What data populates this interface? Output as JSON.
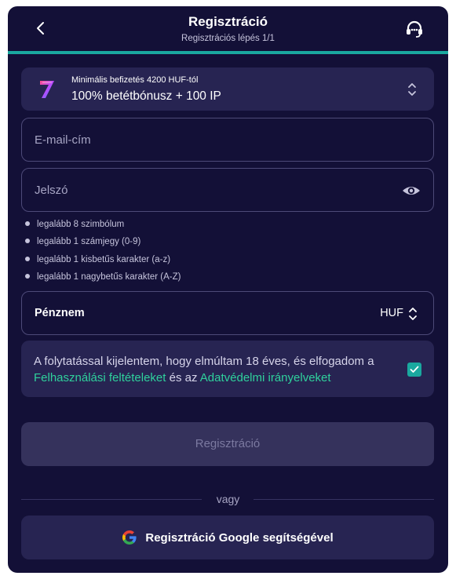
{
  "header": {
    "title": "Regisztráció",
    "subtitle": "Regisztrációs lépés 1/1",
    "back_icon": "chevron-left-icon",
    "support_icon": "headset-icon"
  },
  "progress": {
    "value": 1.0,
    "color": "#1aa89f"
  },
  "bonus": {
    "min_deposit_text": "Minimális befizetés 4200 HUF-tól",
    "offer_text": "100% betétbónusz + 100 IP",
    "logo_icon": "seven-logo-icon"
  },
  "email": {
    "placeholder": "E-mail-cím",
    "value": ""
  },
  "password": {
    "placeholder": "Jelszó",
    "value": "",
    "toggle_icon": "eye-icon"
  },
  "password_rules": [
    "legalább 8 szimbólum",
    "legalább 1 számjegy (0-9)",
    "legalább 1 kisbetűs karakter (a-z)",
    "legalább 1 nagybetűs karakter (A-Z)"
  ],
  "currency": {
    "label": "Pénznem",
    "value": "HUF"
  },
  "terms": {
    "text_before": "A folytatással kijelentem, hogy elmúltam 18 éves, és elfogadom a ",
    "terms_link": "Felhasználási feltételeket",
    "text_middle": " és az ",
    "privacy_link": "Adatvédelmi irányelveket",
    "checked": true
  },
  "submit": {
    "label": "Regisztráció"
  },
  "divider": {
    "text": "vagy"
  },
  "google": {
    "label": "Regisztráció Google segítségével"
  },
  "colors": {
    "background": "#131037",
    "panel": "#272452",
    "accent": "#1aa89f",
    "link": "#2fd19c"
  }
}
